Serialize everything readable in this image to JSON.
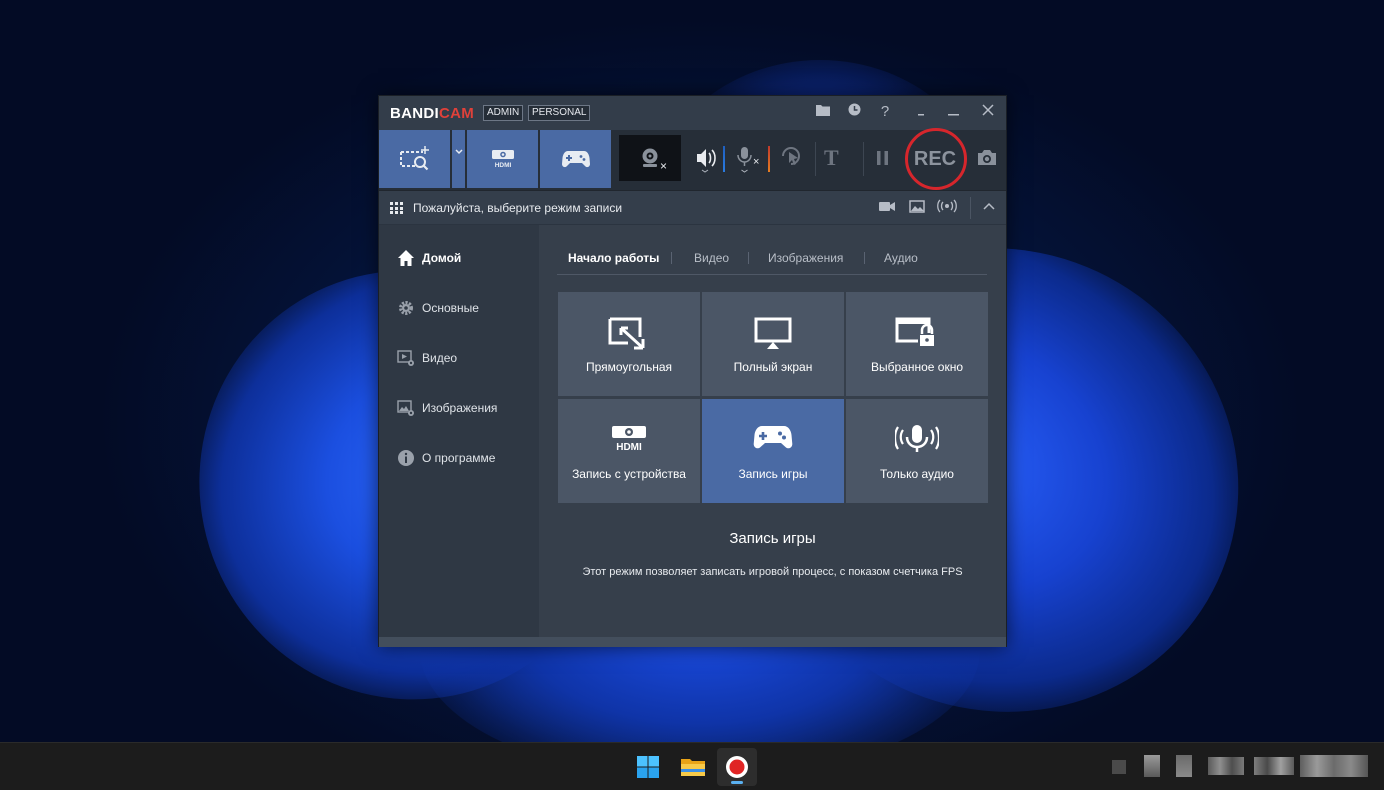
{
  "window": {
    "brand_part1": "BANDI",
    "brand_part2": "CAM",
    "badge_admin": "ADMIN",
    "badge_personal": "PERSONAL"
  },
  "toolbar": {
    "rec_label": "REC"
  },
  "statusbar": {
    "text": "Пожалуйста, выберите режим записи"
  },
  "sidebar": {
    "items": [
      {
        "label": "Домой",
        "icon": "home-icon",
        "active": true
      },
      {
        "label": "Основные",
        "icon": "gear-icon",
        "active": false
      },
      {
        "label": "Видео",
        "icon": "video-settings-icon",
        "active": false
      },
      {
        "label": "Изображения",
        "icon": "image-settings-icon",
        "active": false
      },
      {
        "label": "О программе",
        "icon": "info-icon",
        "active": false
      }
    ]
  },
  "tabs": [
    {
      "label": "Начало работы",
      "active": true
    },
    {
      "label": "Видео",
      "active": false
    },
    {
      "label": "Изображения",
      "active": false
    },
    {
      "label": "Аудио",
      "active": false
    }
  ],
  "modes": [
    {
      "label": "Прямоугольная",
      "icon": "rectangle-select-icon",
      "selected": false
    },
    {
      "label": "Полный экран",
      "icon": "fullscreen-monitor-icon",
      "selected": false
    },
    {
      "label": "Выбранное окно",
      "icon": "locked-window-icon",
      "selected": false
    },
    {
      "label": "Запись с устройства",
      "icon": "hdmi-device-icon",
      "selected": false
    },
    {
      "label": "Запись игры",
      "icon": "gamepad-icon",
      "selected": true
    },
    {
      "label": "Только аудио",
      "icon": "microphone-audio-icon",
      "selected": false
    }
  ],
  "description": {
    "title": "Запись игры",
    "text": "Этот режим позволяет записать игровой процесс, с показом счетчика FPS"
  },
  "colors": {
    "accent": "#4a6aa4",
    "rec_highlight": "#d6262c",
    "brand_red": "#e0413a"
  }
}
